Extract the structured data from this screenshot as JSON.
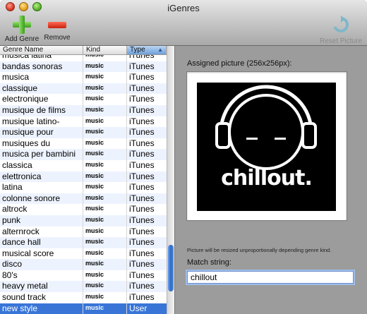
{
  "window": {
    "title": "iGenres"
  },
  "toolbar": {
    "add_label": "Add Genre",
    "remove_label": "Remove",
    "reset_label": "Reset Picture"
  },
  "list": {
    "columns": {
      "name": "Genre Name",
      "kind": "Kind",
      "type": "Type"
    },
    "sort_indicator": "▲",
    "rows": [
      {
        "name": "musica latina",
        "kind": "music",
        "type": "iTunes"
      },
      {
        "name": "bandas sonoras",
        "kind": "music",
        "type": "iTunes"
      },
      {
        "name": "musica",
        "kind": "music",
        "type": "iTunes"
      },
      {
        "name": "classique",
        "kind": "music",
        "type": "iTunes"
      },
      {
        "name": "electronique",
        "kind": "music",
        "type": "iTunes"
      },
      {
        "name": "musique de films",
        "kind": "music",
        "type": "iTunes"
      },
      {
        "name": "musique latino-",
        "kind": "music",
        "type": "iTunes"
      },
      {
        "name": "musique pour",
        "kind": "music",
        "type": "iTunes"
      },
      {
        "name": "musiques du",
        "kind": "music",
        "type": "iTunes"
      },
      {
        "name": "musica per bambini",
        "kind": "music",
        "type": "iTunes"
      },
      {
        "name": "classica",
        "kind": "music",
        "type": "iTunes"
      },
      {
        "name": "elettronica",
        "kind": "music",
        "type": "iTunes"
      },
      {
        "name": "latina",
        "kind": "music",
        "type": "iTunes"
      },
      {
        "name": "colonne sonore",
        "kind": "music",
        "type": "iTunes"
      },
      {
        "name": "altrock",
        "kind": "music",
        "type": "iTunes"
      },
      {
        "name": "punk",
        "kind": "music",
        "type": "iTunes"
      },
      {
        "name": "alternrock",
        "kind": "music",
        "type": "iTunes"
      },
      {
        "name": "dance hall",
        "kind": "music",
        "type": "iTunes"
      },
      {
        "name": "musical score",
        "kind": "music",
        "type": "iTunes"
      },
      {
        "name": "disco",
        "kind": "music",
        "type": "iTunes"
      },
      {
        "name": "80's",
        "kind": "music",
        "type": "iTunes"
      },
      {
        "name": "heavy metal",
        "kind": "music",
        "type": "iTunes"
      },
      {
        "name": "sound track",
        "kind": "music",
        "type": "iTunes"
      },
      {
        "name": "new style",
        "kind": "music",
        "type": "User",
        "selected": true
      }
    ]
  },
  "detail": {
    "picture_label": "Assigned picture (256x256px):",
    "picture_text": "chillout.",
    "resize_note": "Picture will be resized unproportionally depending genre kind.",
    "match_label": "Match string:",
    "match_value": "chillout"
  }
}
